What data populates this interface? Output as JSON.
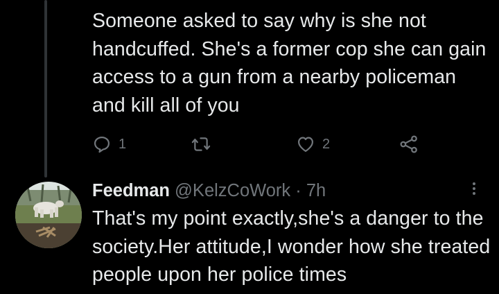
{
  "parent_tweet": {
    "text": "Someone asked to say why is she not handcuffed. She's a former cop she can gain access to a gun from a nearby policeman and kill all of you",
    "actions": {
      "reply_count": "1",
      "retweet_count": "",
      "like_count": "2"
    }
  },
  "reply_tweet": {
    "author_name": "Feedman",
    "author_handle": "@KelzCoWork",
    "separator": "·",
    "timestamp": "7h",
    "text": "That's my point exactly,she's a danger to the society.Her attitude,I wonder how she treated people upon her police times"
  },
  "icons": {
    "reply": "reply-icon",
    "retweet": "retweet-icon",
    "like": "heart-icon",
    "share": "share-icon",
    "more": "more-vertical-icon"
  },
  "colors": {
    "background": "#000000",
    "text": "#e7e9ea",
    "secondary_text": "#71767b",
    "thread_line": "#2f3336"
  }
}
